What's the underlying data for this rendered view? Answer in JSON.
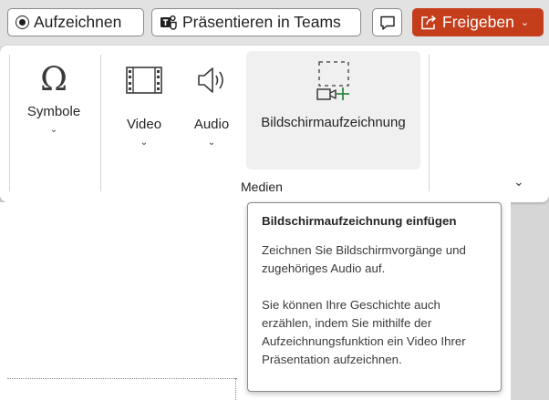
{
  "topbar": {
    "record_label": "Aufzeichnen",
    "teams_label": "Präsentieren in Teams",
    "share_label": "Freigeben",
    "share_color": "#c43e1c"
  },
  "ribbon": {
    "symbols_label": "Symbole",
    "video_label": "Video",
    "audio_label": "Audio",
    "screen_recording_label": "Bildschirmaufzeichnung",
    "group_label": "Medien",
    "chevron": "⌄"
  },
  "tooltip": {
    "title": "Bildschirmaufzeichnung einfügen",
    "paragraph1": "Zeichnen Sie Bildschirmvorgänge und zugehöriges Audio auf.",
    "paragraph2": "Sie können Ihre Geschichte auch erzählen, indem Sie mithilfe der Aufzeichnungsfunktion ein Video Ihrer Präsentation aufzeichnen."
  },
  "icons": {
    "record": "record-icon",
    "teams": "teams-icon",
    "comment": "comment-icon",
    "share": "share-icon",
    "symbols": "omega-icon",
    "video": "film-icon",
    "audio": "speaker-icon",
    "screen_recording": "screen-recording-icon"
  }
}
